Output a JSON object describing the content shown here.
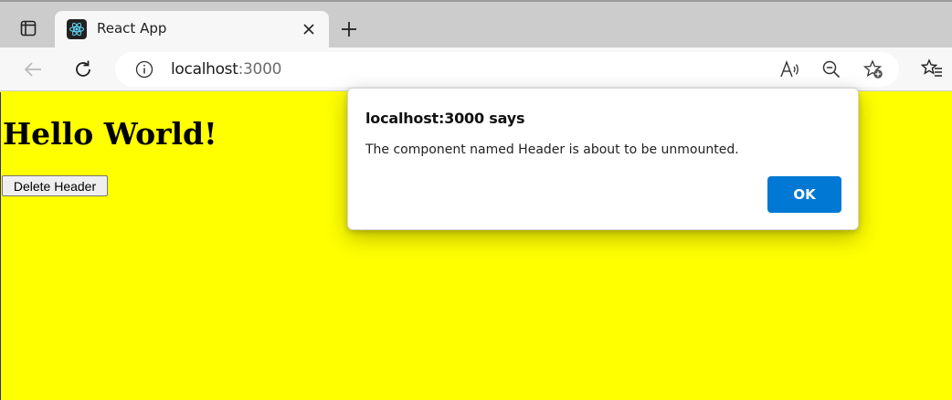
{
  "browser": {
    "tab": {
      "title": "React App",
      "favicon": "react-icon"
    },
    "address": {
      "host": "localhost",
      "port": ":3000"
    },
    "icons": {
      "tab_actions": "tab-actions-icon",
      "close_tab": "close-icon",
      "new_tab": "plus-icon",
      "back": "back-arrow-icon",
      "reload": "reload-icon",
      "site_info": "info-icon",
      "read_aloud": "read-aloud-icon",
      "zoom": "zoom-out-icon",
      "add_favorite": "add-favorite-icon",
      "favorites": "favorites-icon"
    }
  },
  "page": {
    "heading": "Hello World!",
    "delete_button_label": "Delete Header",
    "background_color": "#ffff00"
  },
  "dialog": {
    "title": "localhost:3000 says",
    "message": "The component named Header is about to be unmounted.",
    "ok_label": "OK",
    "ok_color": "#0078d4"
  }
}
